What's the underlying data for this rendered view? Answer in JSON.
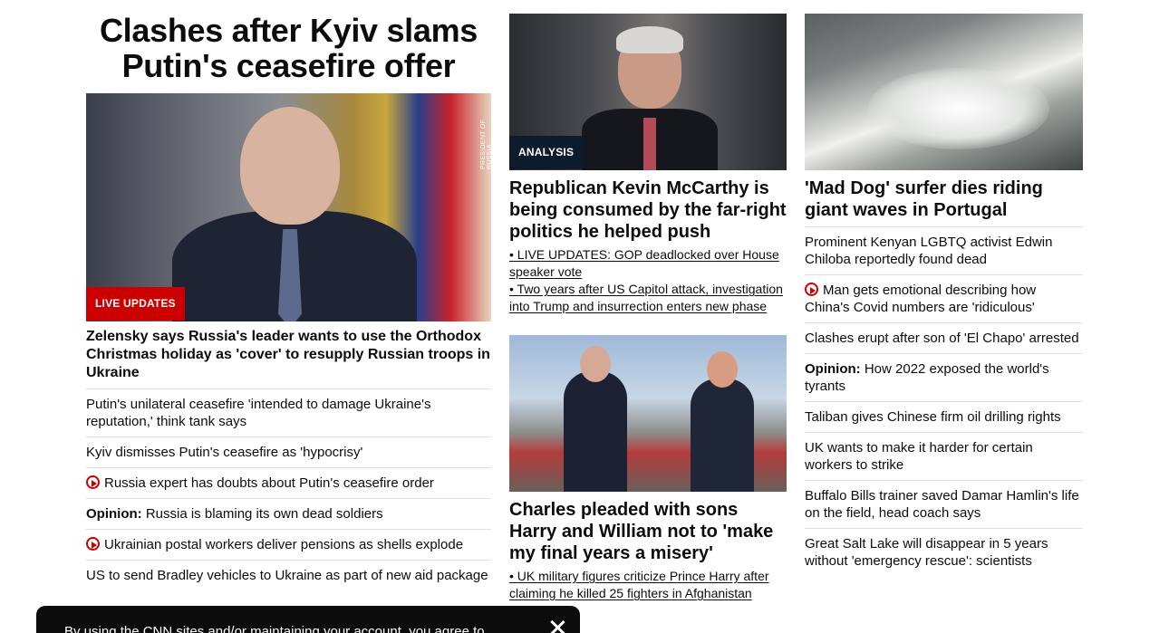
{
  "lead": {
    "headline": "Clashes after Kyiv slams Putin's ceasefire offer",
    "image_credit": "PRESIDENT OF RUSSIA",
    "badge": "LIVE UPDATES",
    "story": "Zelensky says Russia's leader wants to use the Orthodox Christmas holiday as 'cover' to resupply Russian troops in Ukraine",
    "related": [
      {
        "text": "Putin's unilateral ceasefire 'intended to damage Ukraine's reputation,' think tank says",
        "video": false
      },
      {
        "text": "Kyiv dismisses Putin's ceasefire as 'hypocrisy'",
        "video": false
      },
      {
        "text": "Russia expert has doubts about Putin's ceasefire order",
        "video": true
      },
      {
        "prefix": "Opinion:",
        "text": "Russia is blaming its own dead soldiers",
        "video": false
      },
      {
        "text": "Ukrainian postal workers deliver pensions as shells explode",
        "video": true
      },
      {
        "text": "US to send Bradley vehicles to Ukraine as part of new aid package",
        "video": false
      }
    ]
  },
  "mccarthy": {
    "badge": "ANALYSIS",
    "headline": "Republican Kevin McCarthy is being consumed by the far-right politics he helped push",
    "links": [
      "• LIVE UPDATES: GOP deadlocked over House speaker vote",
      "• Two years after US Capitol attack, investigation into Trump and insurrection enters new phase"
    ]
  },
  "royals": {
    "headline": "Charles pleaded with sons Harry and William not to 'make my final years a misery'",
    "links": [
      "• UK military figures criticize Prince Harry after claiming he killed 25 fighters in Afghanistan"
    ]
  },
  "surfer": {
    "headline": "'Mad Dog' surfer dies riding giant waves in Portugal",
    "list": [
      {
        "text": "Prominent Kenyan LGBTQ activist Edwin Chiloba reportedly found dead",
        "video": false
      },
      {
        "text": "Man gets emotional describing how China's Covid numbers are 'ridiculous'",
        "video": true
      },
      {
        "text": "Clashes erupt after son of 'El Chapo' arrested",
        "video": false
      },
      {
        "prefix": "Opinion:",
        "text": "How 2022 exposed the world's tyrants",
        "video": false
      },
      {
        "text": "Taliban gives Chinese firm oil drilling rights",
        "video": false
      },
      {
        "text": "UK wants to make it harder for certain workers to strike",
        "video": false
      },
      {
        "text": "Buffalo Bills trainer saved Damar Hamlin's life on the field, head coach says",
        "video": false
      },
      {
        "text": "Great Salt Lake will disappear in 5 years without 'emergency rescue': scientists",
        "video": false
      }
    ]
  },
  "cookie": {
    "text": "By using the CNN sites and/or maintaining your account, you agree to"
  },
  "colors": {
    "live_badge": "#cc0000",
    "analysis_badge": "#0c1c2c",
    "video_icon": "#cc0000",
    "banner": "#0c0c0c"
  }
}
